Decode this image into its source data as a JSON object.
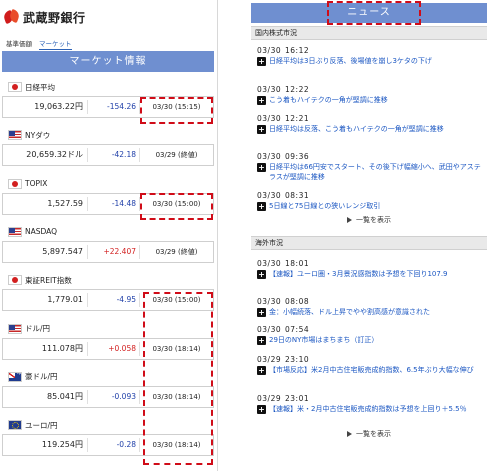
{
  "bank": {
    "name": "武蔵野銀行"
  },
  "subnav": {
    "items": [
      "基準価額",
      "マーケット"
    ],
    "active": "マーケット"
  },
  "market": {
    "title": "マーケット情報",
    "items": [
      {
        "flag": "flag-jp",
        "name": "日経平均",
        "value": "19,063.22円",
        "change": "-154.26",
        "time": "03/30 (15:15)"
      },
      {
        "flag": "flag-us",
        "name": "NYダウ",
        "value": "20,659.32ドル",
        "change": "-42.18",
        "time": "03/29 (終値)"
      },
      {
        "flag": "flag-jp",
        "name": "TOPIX",
        "value": "1,527.59",
        "change": "-14.48",
        "time": "03/30 (15:00)"
      },
      {
        "flag": "flag-us",
        "name": "NASDAQ",
        "value": "5,897.547",
        "change": "+22.407",
        "time": "03/29 (終値)"
      },
      {
        "flag": "flag-jp",
        "name": "東証REIT指数",
        "value": "1,779.01",
        "change": "-4.95",
        "time": "03/30 (15:00)"
      },
      {
        "flag": "flag-us",
        "name": "ドル/円",
        "value": "111.078円",
        "change": "+0.058",
        "time": "03/30 (18:14)"
      },
      {
        "flag": "flag-au",
        "name": "豪ドル/円",
        "value": "85.041円",
        "change": "-0.093",
        "time": "03/30 (18:14)"
      },
      {
        "flag": "flag-eu",
        "name": "ユーロ/円",
        "value": "119.254円",
        "change": "-0.28",
        "time": "03/30 (18:14)"
      }
    ]
  },
  "news": {
    "title": "ニュース",
    "domestic": {
      "title": "国内株式市況",
      "items": [
        {
          "date": "03/30",
          "time": "16:12",
          "text": "日経平均は3日ぶり反落、後場値を崩し3ケタの下げ"
        },
        {
          "date": "03/30",
          "time": "12:22",
          "text": "こう着もハイテクの一角が堅調に推移"
        },
        {
          "date": "03/30",
          "time": "12:21",
          "text": "日経平均は反落、こう着もハイテクの一角が堅調に推移"
        },
        {
          "date": "03/30",
          "time": "09:36",
          "text": "日経平均は66円安でスタート、その後下げ幅縮小へ、武田やアステラスが堅調に推移"
        },
        {
          "date": "03/30",
          "time": "08:31",
          "text": "5日線と75日線との狭いレンジ取引"
        }
      ],
      "more": "一覧を表示"
    },
    "overseas": {
      "title": "海外市況",
      "items": [
        {
          "date": "03/30",
          "time": "18:01",
          "text": "【速報】ユーロ圏・3月景況感指数は予想を下回り107.9"
        },
        {
          "date": "03/30",
          "time": "08:08",
          "text": "金：小幅続落、ドル上昇でやや割高感が意識された"
        },
        {
          "date": "03/30",
          "time": "07:54",
          "text": "29日のNY市場はまちまち（訂正）"
        },
        {
          "date": "03/29",
          "time": "23:10",
          "text": "【市場反応】米2月中古住宅販売成約指数、6.5年ぶり大幅な伸び"
        },
        {
          "date": "03/29",
          "time": "23:01",
          "text": "【速報】米・2月中古住宅販売成約指数は予想を上回り＋5.5％"
        }
      ],
      "more": "一覧を表示"
    }
  }
}
